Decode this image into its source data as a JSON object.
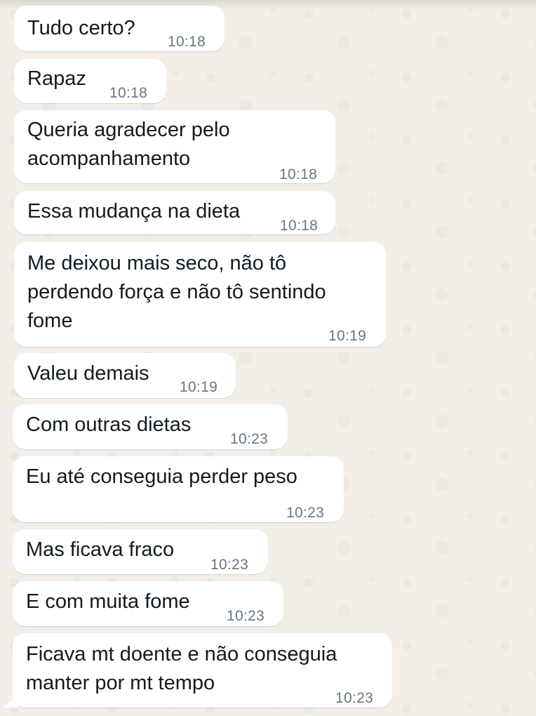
{
  "chat": {
    "messages": [
      {
        "text": "Tudo certo?",
        "time": "10:18"
      },
      {
        "text": "Rapaz",
        "time": "10:18"
      },
      {
        "text": "Queria agradecer pelo\nacompanhamento",
        "time": "10:18"
      },
      {
        "text": "Essa mudança na dieta",
        "time": "10:18"
      },
      {
        "text": "Me deixou mais seco, não tô\nperdendo força e não tô sentindo\nfome",
        "time": "10:19"
      },
      {
        "text": "Valeu demais",
        "time": "10:19"
      },
      {
        "text": "Com outras dietas",
        "time": "10:23"
      },
      {
        "text": "Eu até conseguia perder peso",
        "time": "10:23"
      },
      {
        "text": "Mas ficava fraco",
        "time": "10:23"
      },
      {
        "text": "E com muita fome",
        "time": "10:23"
      },
      {
        "text": "Ficava mt doente e não conseguia\nmanter por mt tempo",
        "time": "10:23"
      }
    ],
    "colors": {
      "bubble": "#ffffff",
      "background": "#efeae2",
      "text": "#111b21",
      "timestamp": "#667781"
    }
  }
}
